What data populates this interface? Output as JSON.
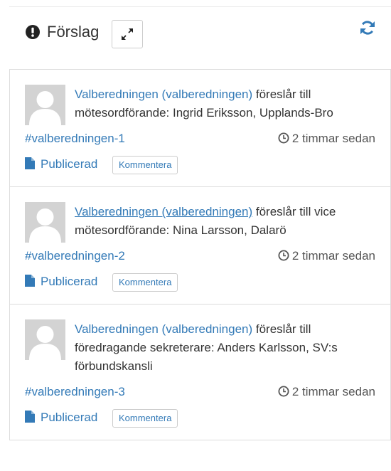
{
  "panel": {
    "title": "Förslag",
    "icons": {
      "title": "exclamation-circle-icon",
      "expand": "expand-icon",
      "refresh": "refresh-icon"
    }
  },
  "items": [
    {
      "author": "Valberedningen (valberedningen)",
      "text": " föreslår till mötesordförande: Ingrid Eriksson, Upplands-Bro",
      "tag": "#valberedningen-1",
      "time": "2 timmar sedan",
      "status": "Publicerad",
      "comment": "Kommentera"
    },
    {
      "author": "Valberedningen (valberedningen)",
      "text": " föreslår till vice mötesordförande: Nina Larsson, Dalarö",
      "tag": "#valberedningen-2",
      "time": "2 timmar sedan",
      "status": "Publicerad",
      "comment": "Kommentera"
    },
    {
      "author": "Valberedningen (valberedningen)",
      "text": " föreslår till föredragande sekreterare: Anders Karlsson, SV:s förbundskansli",
      "tag": "#valberedningen-3",
      "time": "2 timmar sedan",
      "status": "Publicerad",
      "comment": "Kommentera"
    }
  ],
  "colors": {
    "link": "#337ab7",
    "border": "#dddddd",
    "avatar": "#d3d3d3"
  }
}
